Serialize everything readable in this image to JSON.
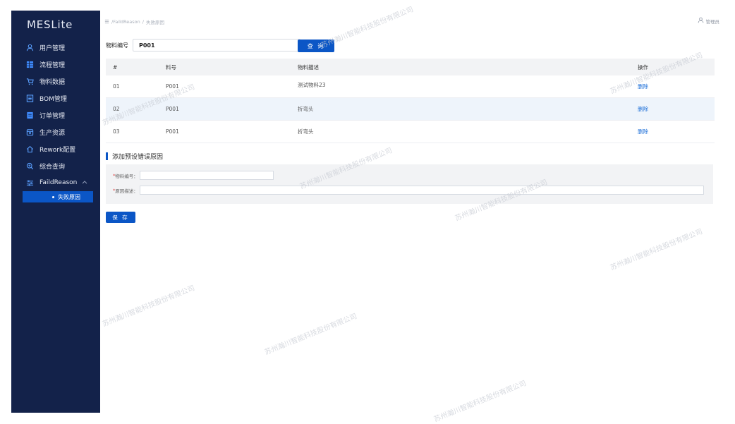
{
  "app": {
    "title": "MESLite"
  },
  "sidebar": {
    "items": [
      {
        "label": "用户管理",
        "icon": "user-icon"
      },
      {
        "label": "流程管理",
        "icon": "grid-icon"
      },
      {
        "label": "物料数据",
        "icon": "cart-icon"
      },
      {
        "label": "BOM管理",
        "icon": "list-box-icon"
      },
      {
        "label": "订单管理",
        "icon": "document-icon"
      },
      {
        "label": "生产资源",
        "icon": "box-icon"
      },
      {
        "label": "Rework配置",
        "icon": "home-icon"
      },
      {
        "label": "综合查询",
        "icon": "search-icon"
      },
      {
        "label": "FaildReason",
        "icon": "sliders-icon"
      }
    ],
    "subitem": {
      "label": "失败原因"
    }
  },
  "breadcrumb": {
    "part1": "/FaildReason",
    "part2": "失败原因"
  },
  "header": {
    "user": "管理员"
  },
  "search": {
    "label": "物料编号",
    "value": "P001",
    "button": "查 询"
  },
  "table": {
    "headers": [
      "#",
      "料号",
      "物料描述",
      "操作"
    ],
    "rows": [
      {
        "idx": "01",
        "code": "P001",
        "desc": "测试物料23",
        "action": "删除"
      },
      {
        "idx": "02",
        "code": "P001",
        "desc": "折弯头",
        "action": "删除"
      },
      {
        "idx": "03",
        "code": "P001",
        "desc": "折弯头",
        "action": "删除"
      }
    ]
  },
  "form": {
    "title": "添加预设错误原因",
    "material_label": "物料编号：",
    "reason_label": "原因描述：",
    "required_mark": "*",
    "save_button": "保 存"
  },
  "watermark": "苏州瀚川智能科技股份有限公司",
  "colors": {
    "sidebar_bg": "#13224a",
    "accent": "#0b56c6",
    "link": "#1d6fd8"
  }
}
